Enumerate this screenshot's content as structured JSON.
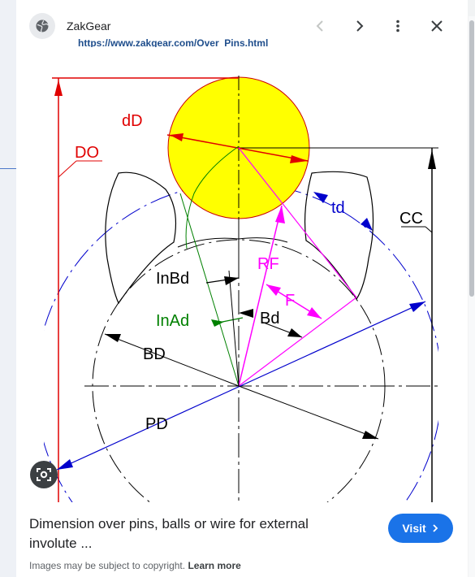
{
  "header": {
    "site_name": "ZakGear",
    "url": "https://www.zakgear.com/Over_Pins.html"
  },
  "figure": {
    "labels": {
      "dD": "dD",
      "DO": "DO",
      "td": "td",
      "CC": "CC",
      "RF": "RF",
      "InBd": "InBd",
      "F": "F",
      "InAd": "InAd",
      "Bd": "Bd",
      "BD": "BD",
      "PD": "PD"
    }
  },
  "footer": {
    "caption": "Dimension over pins, balls or wire for external involute ...",
    "visit_label": "Visit",
    "copyright": "Images may be subject to copyright.",
    "learn_more": "Learn more"
  },
  "colors": {
    "accent": "#1a73e8",
    "red": "#e00000",
    "magenta": "#ff00ff",
    "blue": "#0000cc",
    "green": "#008000",
    "yellow": "#ffff00"
  },
  "icons": {
    "globe": "globe-icon",
    "back": "chevron-left-icon",
    "forward": "chevron-right-icon",
    "more": "more-vert-icon",
    "close": "close-icon",
    "lens": "lens-icon",
    "visit_arrow": "chevron-right-icon"
  }
}
